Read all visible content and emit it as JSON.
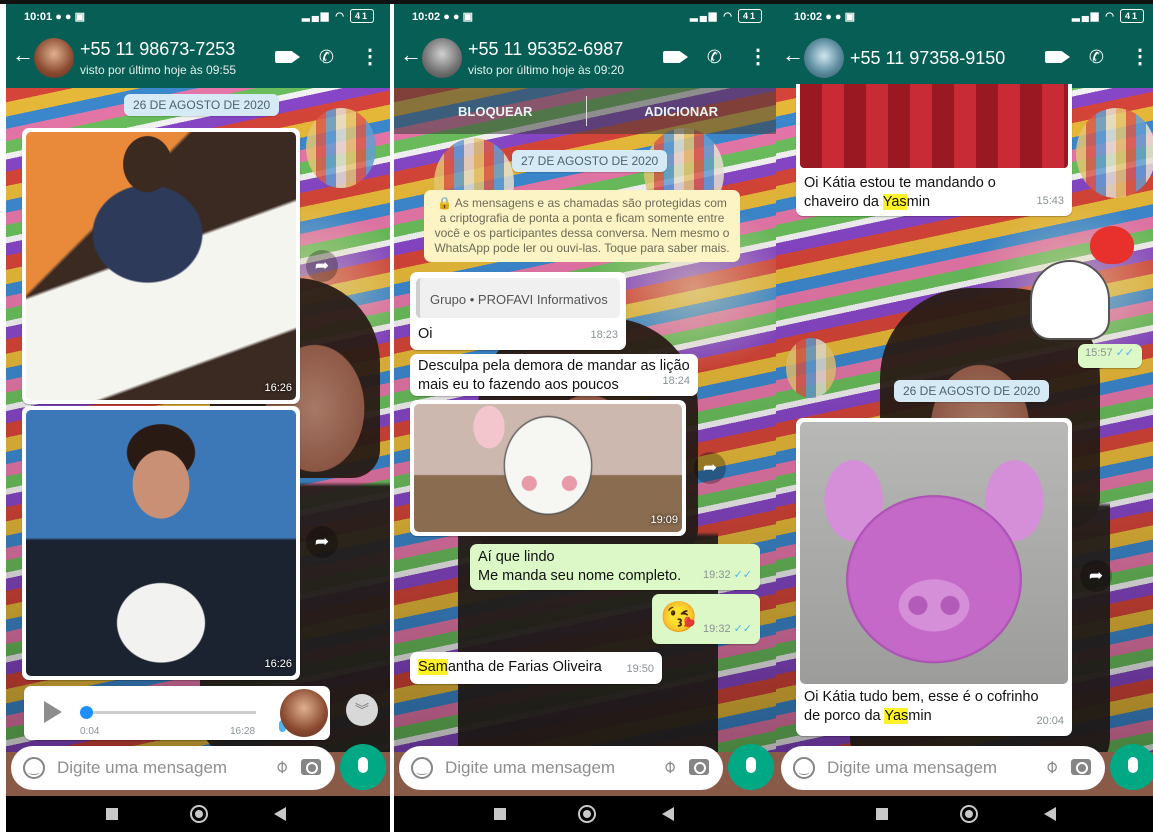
{
  "phones": [
    {
      "status": {
        "time": "10:01",
        "battery": "41"
      },
      "header": {
        "title": "+55 11 98673-7253",
        "subtitle": "visto por último hoje às 09:55"
      },
      "date_chip": "26 DE AGOSTO DE 2020",
      "photos": [
        {
          "time": "16:26"
        },
        {
          "time": "16:26"
        }
      ],
      "audio": {
        "duration": "0:04",
        "time": "16:28"
      },
      "input_placeholder": "Digite uma mensagem"
    },
    {
      "status": {
        "time": "10:02",
        "battery": "41"
      },
      "header": {
        "title": "+55 11 95352-6987",
        "subtitle": "visto por último hoje às 09:20"
      },
      "actions": {
        "block": "BLOQUEAR",
        "add": "ADICIONAR"
      },
      "date_chip": "27 DE AGOSTO DE 2020",
      "encryption_notice": "🔒 As mensagens e as chamadas são protegidas com a criptografia de ponta a ponta e ficam somente entre você e os participantes dessa conversa. Nem mesmo o WhatsApp pode ler ou ouvi-las. Toque para saber mais.",
      "messages": [
        {
          "quote": "Grupo • PROFAVI Informativos",
          "text": "Oi",
          "time": "18:23"
        },
        {
          "text": "Desculpa pela demora de mandar as lição mais eu to fazendo aos poucos",
          "time": "18:24"
        },
        {
          "photo": true,
          "time": "19:09"
        },
        {
          "text": "Aí que lindo\nMe manda seu nome completo.",
          "time": "19:32",
          "outgoing": true
        },
        {
          "emoji": "😘",
          "time": "19:32",
          "outgoing": true
        },
        {
          "text_highlight": "Sam",
          "text_rest": "antha de Farias Oliveira",
          "time": "19:50"
        }
      ],
      "input_placeholder": "Digite uma mensagem"
    },
    {
      "status": {
        "time": "10:02",
        "battery": "41"
      },
      "header": {
        "title": "+55 11 97358-9150"
      },
      "messages": [
        {
          "text_a": "Oi Kátia estou te mandando o chaveiro da ",
          "highlight": "Yas",
          "text_b": "min",
          "time": "15:43"
        },
        {
          "sticker": true,
          "time": "15:57",
          "outgoing": true
        },
        {
          "date_chip": "26 DE AGOSTO DE 2020"
        },
        {
          "text_a": "Oi Kátia tudo bem, esse é o cofrinho de porco da ",
          "highlight": "Yas",
          "text_b": "min",
          "time": "20:04"
        }
      ],
      "input_placeholder": "Digite uma mensagem"
    }
  ],
  "icons": [
    "back-arrow-icon",
    "video-call-icon",
    "phone-icon",
    "more-options-icon",
    "forward-icon",
    "emoji-icon",
    "attach-icon",
    "camera-icon",
    "mic-icon",
    "play-icon",
    "scroll-down-icon",
    "lock-icon"
  ],
  "colors": {
    "header": "#075e54",
    "outgoing_bubble": "#dcf8c6",
    "incoming_bubble": "#ffffff",
    "mic_button": "#00a884",
    "highlight": "#fff227",
    "read_ticks": "#4fb6ec"
  }
}
